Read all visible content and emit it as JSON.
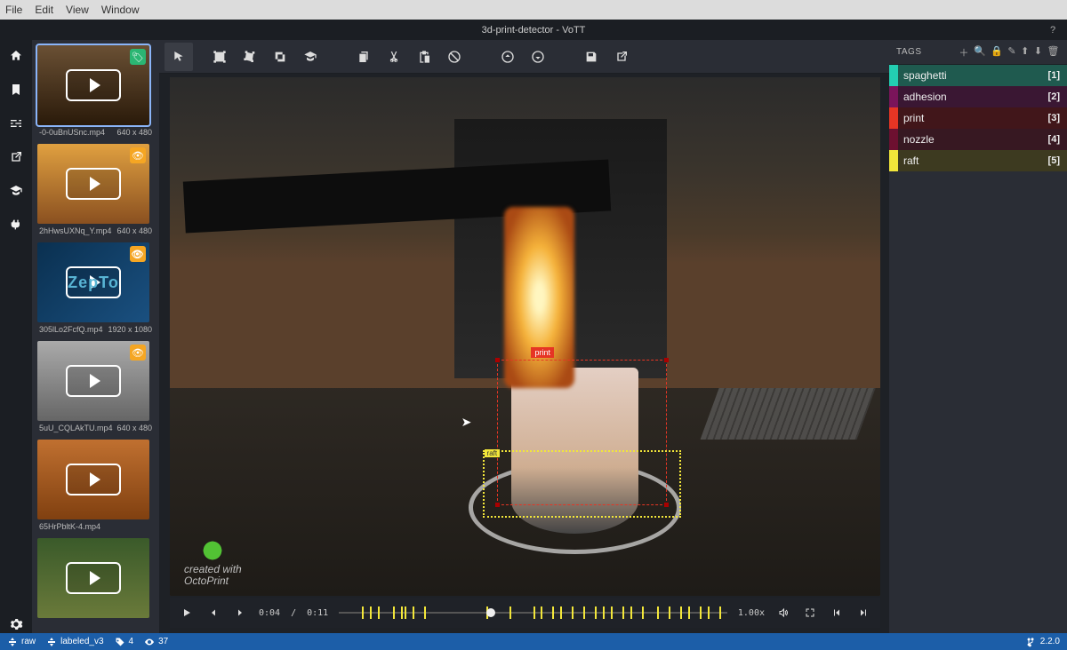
{
  "menu": {
    "items": [
      "File",
      "Edit",
      "View",
      "Window"
    ]
  },
  "title": "3d-print-detector - VoTT",
  "sidebar_icons": [
    "home",
    "bookmark",
    "sliders",
    "export",
    "graduation",
    "plug"
  ],
  "thumbnails": [
    {
      "name": "-0-0uBnUSnc.mp4",
      "dims": "640 x 480",
      "badge": "tag",
      "selected": true,
      "bg": "th1"
    },
    {
      "name": "2hHwsUXNq_Y.mp4",
      "dims": "640 x 480",
      "badge": "eye",
      "bg": "th2"
    },
    {
      "name": "305lLo2FcfQ.mp4",
      "dims": "1920 x 1080",
      "badge": "eye",
      "bg": "th3",
      "text": "ZepTo"
    },
    {
      "name": "5uU_CQLAkTU.mp4",
      "dims": "640 x 480",
      "badge": "eye",
      "bg": "th4"
    },
    {
      "name": "65HrPbltK-4.mp4",
      "dims": "",
      "badge": "",
      "bg": "th5"
    },
    {
      "name": "",
      "dims": "",
      "badge": "",
      "bg": "th6"
    }
  ],
  "toolbar": [
    "pointer",
    "rect",
    "poly",
    "copyregion",
    "graduation",
    "sep",
    "copy",
    "cut",
    "paste",
    "no",
    "sep2",
    "up",
    "down",
    "sep3",
    "save",
    "export"
  ],
  "video": {
    "current_time": "0:04",
    "duration": "0:11",
    "rate": "1.00x",
    "tick_positions_pct": [
      6,
      8,
      10,
      14,
      16,
      17,
      19,
      22,
      38,
      44,
      50,
      52,
      55,
      57,
      60,
      63,
      66,
      68,
      70,
      73,
      75,
      78,
      82,
      85,
      88,
      90,
      93,
      95,
      98
    ],
    "knob_pct": 38
  },
  "boxes": {
    "print_label": "print",
    "raft_label": "raft"
  },
  "watermark": {
    "line1": "created with",
    "line2": "OctoPrint"
  },
  "tags": {
    "header": "TAGS",
    "items": [
      {
        "name": "spaghetti",
        "key": "[1]",
        "swatch": "#23ceb2",
        "bg": "#1f5a4f"
      },
      {
        "name": "adhesion",
        "key": "[2]",
        "swatch": "#7a145a",
        "bg": "#3a1733"
      },
      {
        "name": "print",
        "key": "[3]",
        "swatch": "#e63524",
        "bg": "#41161a"
      },
      {
        "name": "nozzle",
        "key": "[4]",
        "swatch": "#6d1030",
        "bg": "#371822"
      },
      {
        "name": "raft",
        "key": "[5]",
        "swatch": "#f2e63a",
        "bg": "#3d3a20"
      }
    ]
  },
  "status": {
    "src": "raw",
    "dst": "labeled_v3",
    "tags_count": "4",
    "visited": "37",
    "version": "2.2.0"
  }
}
